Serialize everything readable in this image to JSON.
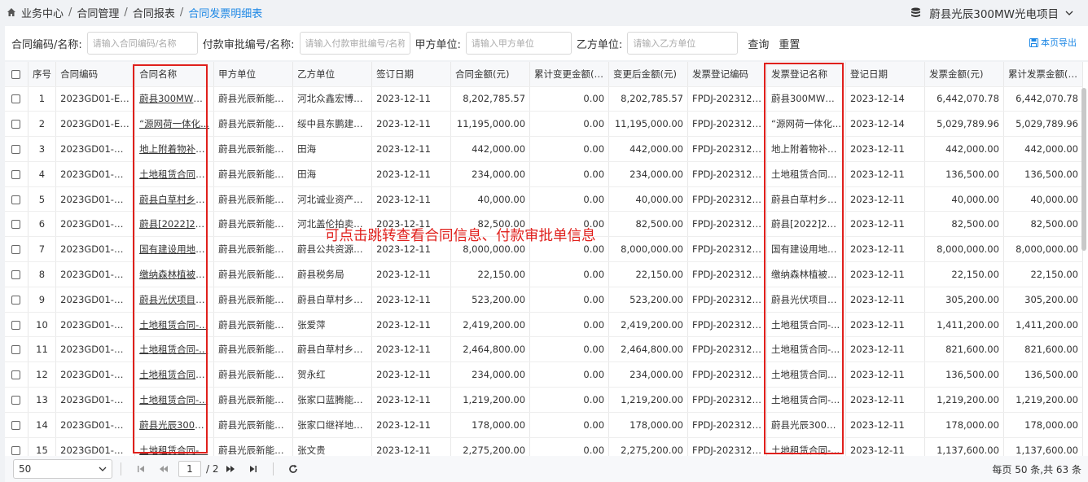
{
  "breadcrumb": {
    "items": [
      "业务中心",
      "合同管理",
      "合同报表"
    ],
    "current": "合同发票明细表"
  },
  "project": {
    "name": "蔚县光辰300MW光电项目"
  },
  "filters": {
    "contract_label": "合同编码/名称:",
    "contract_placeholder": "请输入合同编码/名称",
    "payment_label": "付款审批编号/名称:",
    "payment_placeholder": "请输入付款审批编号/名称",
    "party_a_label": "甲方单位:",
    "party_a_placeholder": "请输入甲方单位",
    "party_b_label": "乙方单位:",
    "party_b_placeholder": "请输入乙方单位",
    "query_label": "查询",
    "reset_label": "重置",
    "export_label": "本页导出"
  },
  "table": {
    "columns": [
      "序号",
      "合同编码",
      "合同名称",
      "甲方单位",
      "乙方单位",
      "签订日期",
      "合同金额(元)",
      "累计变更金额(元)",
      "变更后金额(元)",
      "发票登记编码",
      "发票登记名称",
      "登记日期",
      "发票金额(元)",
      "累计发票金额(不含"
    ],
    "rows": [
      [
        "1",
        "2023GD01-E&...",
        "蔚县300MW项...",
        "蔚县光辰新能源...",
        "河北众鑫宏博建...",
        "2023-12-11",
        "8,202,785.57",
        "0.00",
        "8,202,785.57",
        "FPDJ-202312-...",
        "蔚县300MW项...",
        "2023-12-14",
        "6,442,070.78",
        "6,442,070.78"
      ],
      [
        "2",
        "2023GD01-E&...",
        "“源网荷一体化...",
        "蔚县光辰新能源...",
        "绥中县东鹏建筑...",
        "2023-12-11",
        "11,195,000.00",
        "0.00",
        "11,195,000.00",
        "FPDJ-202312-...",
        "“源网荷一体化...",
        "2023-12-14",
        "5,029,789.96",
        "5,029,789.96"
      ],
      [
        "3",
        "2023GD01-D&...",
        "地上附着物补偿...",
        "蔚县光辰新能源...",
        "田海",
        "2023-12-11",
        "442,000.00",
        "0.00",
        "442,000.00",
        "FPDJ-202312-...",
        "地上附着物补偿...",
        "2023-12-11",
        "442,000.00",
        "442,000.00"
      ],
      [
        "4",
        "2023GD01-D&...",
        "土地租赁合同（...",
        "蔚县光辰新能源...",
        "田海",
        "2023-12-11",
        "234,000.00",
        "0.00",
        "234,000.00",
        "FPDJ-202312-...",
        "土地租赁合同（...",
        "2023-12-11",
        "136,500.00",
        "136,500.00"
      ],
      [
        "5",
        "2023GD01-D&...",
        "蔚县白草村乡楼...",
        "蔚县光辰新能源...",
        "河北诚业资产评...",
        "2023-12-11",
        "40,000.00",
        "0.00",
        "40,000.00",
        "FPDJ-202312-...",
        "蔚县白草村乡楼...",
        "2023-12-11",
        "40,000.00",
        "40,000.00"
      ],
      [
        "6",
        "2023GD01-D&...",
        "蔚县[2022]20号...",
        "蔚县光辰新能源...",
        "河北盖伦拍卖有...",
        "2023-12-11",
        "82,500.00",
        "0.00",
        "82,500.00",
        "FPDJ-202312-...",
        "蔚县[2022]20号...",
        "2023-12-11",
        "82,500.00",
        "82,500.00"
      ],
      [
        "7",
        "2023GD01-D&...",
        "国有建设用地使...",
        "蔚县光辰新能源...",
        "蔚县公共资源交...",
        "2023-12-11",
        "8,000,000.00",
        "0.00",
        "8,000,000.00",
        "FPDJ-202312-...",
        "国有建设用地使...",
        "2023-12-11",
        "8,000,000.00",
        "8,000,000.00"
      ],
      [
        "8",
        "2023GD01-D&...",
        "缴纳森林植被恢...",
        "蔚县光辰新能源...",
        "蔚县税务局",
        "2023-12-11",
        "22,150.00",
        "0.00",
        "22,150.00",
        "FPDJ-202312-...",
        "缴纳森林植被恢...",
        "2023-12-11",
        "22,150.00",
        "22,150.00"
      ],
      [
        "9",
        "2023GD01-D&...",
        "蔚县光伏项目与...",
        "蔚县光辰新能源...",
        "蔚县白草村乡娘...",
        "2023-12-11",
        "523,200.00",
        "0.00",
        "523,200.00",
        "FPDJ-202312-...",
        "蔚县光伏项目与...",
        "2023-12-11",
        "305,200.00",
        "305,200.00"
      ],
      [
        "10",
        "2023GD01-D&...",
        "土地租赁合同-...",
        "蔚县光辰新能源...",
        "张爱萍",
        "2023-12-11",
        "2,419,200.00",
        "0.00",
        "2,419,200.00",
        "FPDJ-202312-...",
        "土地租赁合同-...",
        "2023-12-11",
        "1,411,200.00",
        "1,411,200.00"
      ],
      [
        "11",
        "2023GD01-D&...",
        "土地租赁合同-...",
        "蔚县光辰新能源...",
        "蔚县白草村乡柏...",
        "2023-12-11",
        "2,464,800.00",
        "0.00",
        "2,464,800.00",
        "FPDJ-202312-...",
        "土地租赁合同-...",
        "2023-12-11",
        "821,600.00",
        "821,600.00"
      ],
      [
        "12",
        "2023GD01-D&...",
        "土地租赁合同楼...",
        "蔚县光辰新能源...",
        "贺永红",
        "2023-12-11",
        "234,000.00",
        "0.00",
        "234,000.00",
        "FPDJ-202312-...",
        "土地租赁合同楼...",
        "2023-12-11",
        "136,500.00",
        "136,500.00"
      ],
      [
        "13",
        "2023GD01-D&...",
        "土地租赁合同-...",
        "蔚县光辰新能源...",
        "张家口蓝腾能源...",
        "2023-12-11",
        "1,219,200.00",
        "0.00",
        "1,219,200.00",
        "FPDJ-202312-...",
        "土地租赁合同-...",
        "2023-12-11",
        "1,219,200.00",
        "1,219,200.00"
      ],
      [
        "14",
        "2023GD01-D&...",
        "蔚县光辰300M...",
        "蔚县光辰新能源...",
        "张家口继祥地理...",
        "2023-12-11",
        "178,000.00",
        "0.00",
        "178,000.00",
        "FPDJ-202312-...",
        "蔚县光辰300M...",
        "2023-12-11",
        "178,000.00",
        "178,000.00"
      ],
      [
        "15",
        "2023GD01-D&...",
        "土地租赁合同-...",
        "蔚县光辰新能源...",
        "张文贵",
        "2023-12-11",
        "2,275,200.00",
        "0.00",
        "2,275,200.00",
        "FPDJ-202312-...",
        "土地租赁合同-...",
        "2023-12-11",
        "1,137,600.00",
        "1,137,600.00"
      ]
    ]
  },
  "annotation": "可点击跳转查看合同信息、付款审批单信息",
  "pagination": {
    "page_size": "50",
    "current_page": "1",
    "total_pages": "/ 2",
    "summary": "每页 50 条,共 63 条"
  },
  "colors": {
    "accent": "#1e88e5",
    "annotation": "#e0201c"
  }
}
